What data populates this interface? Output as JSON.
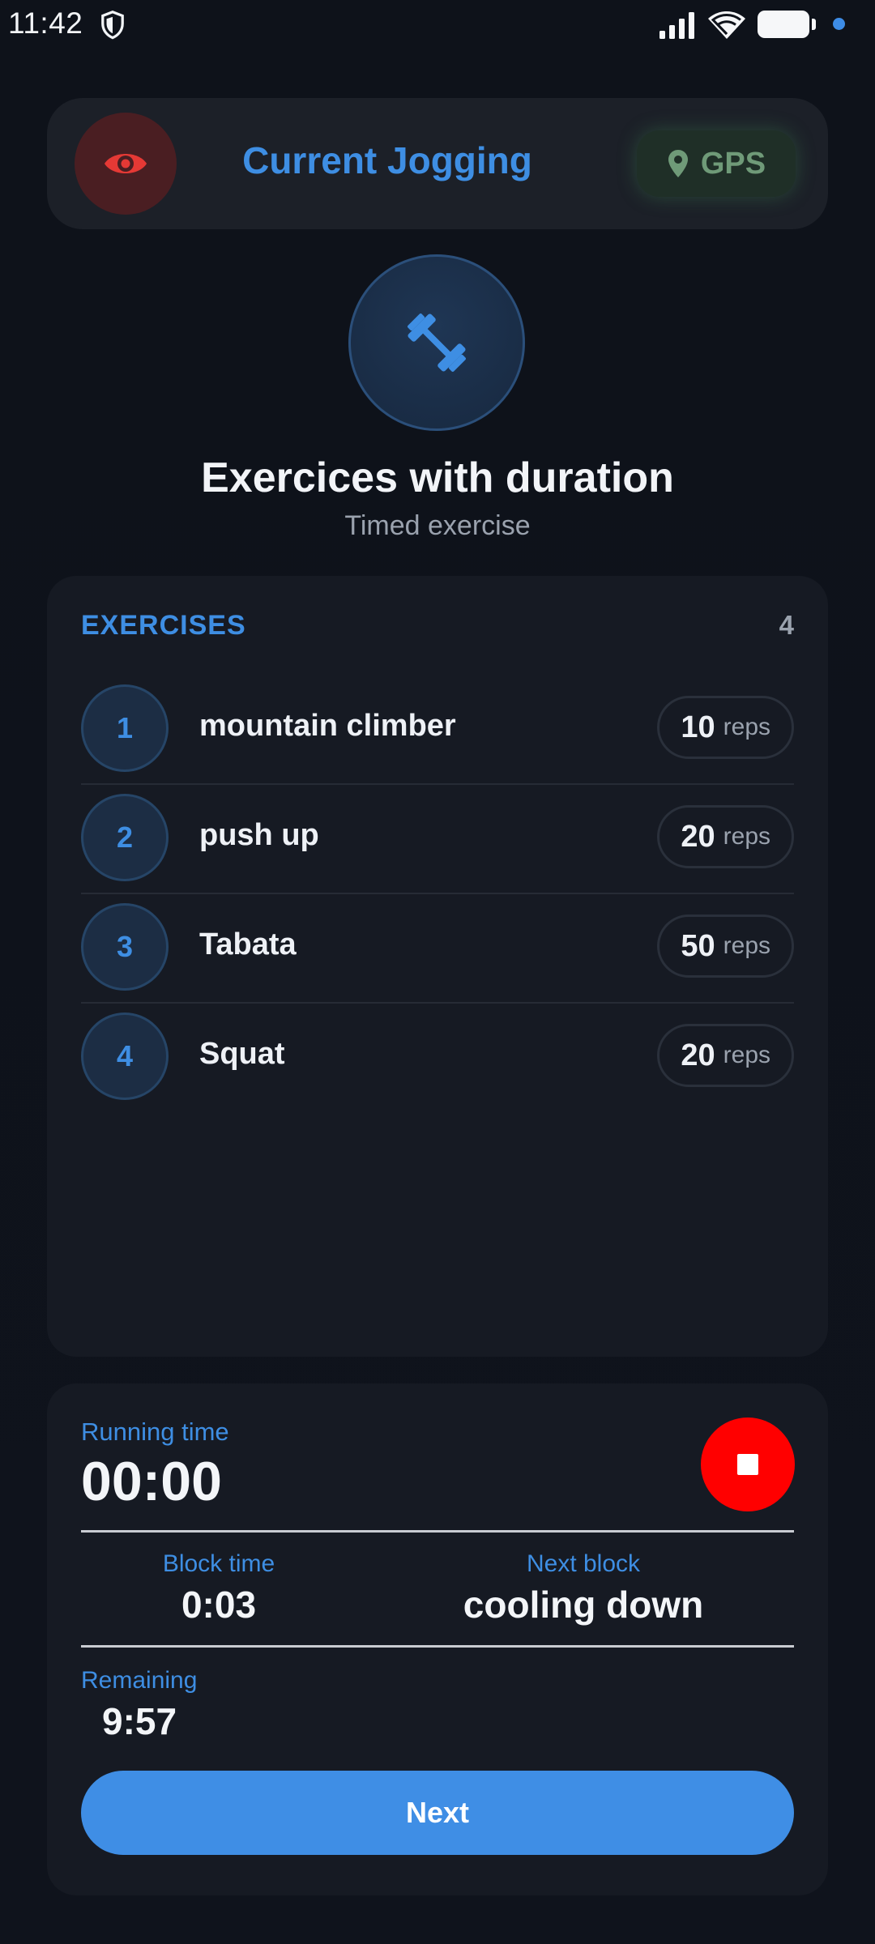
{
  "status_bar": {
    "time": "11:42",
    "icons": [
      "shield-icon",
      "signal-icon",
      "wifi-icon",
      "battery-icon",
      "notification-dot"
    ]
  },
  "header": {
    "title": "Current Jogging",
    "eye_icon": "eye-icon",
    "gps_label": "GPS",
    "gps_icon": "location-pin-icon"
  },
  "hero": {
    "icon": "dumbbell-icon",
    "title": "Exercices with duration",
    "subtitle": "Timed exercise"
  },
  "exercises": {
    "heading": "EXERCISES",
    "count": "4",
    "items": [
      {
        "number": "1",
        "name": "mountain climber",
        "reps": "10",
        "unit": "reps"
      },
      {
        "number": "2",
        "name": "push up",
        "reps": "20",
        "unit": "reps"
      },
      {
        "number": "3",
        "name": "Tabata",
        "reps": "50",
        "unit": "reps"
      },
      {
        "number": "4",
        "name": "Squat",
        "reps": "20",
        "unit": "reps"
      }
    ]
  },
  "timer": {
    "running_label": "Running time",
    "running_value": "00:00",
    "block_time_label": "Block time",
    "block_time_value": "0:03",
    "next_block_label": "Next block",
    "next_block_value": "cooling down",
    "remaining_label": "Remaining",
    "remaining_value": "9:57",
    "next_button_label": "Next",
    "stop_icon": "stop-icon"
  },
  "colors": {
    "background": "#0e121a",
    "card": "#161a23",
    "accent": "#3e8ee3",
    "stop": "#ff0000",
    "eye": "#e53935",
    "gps": "#6f9a78"
  }
}
